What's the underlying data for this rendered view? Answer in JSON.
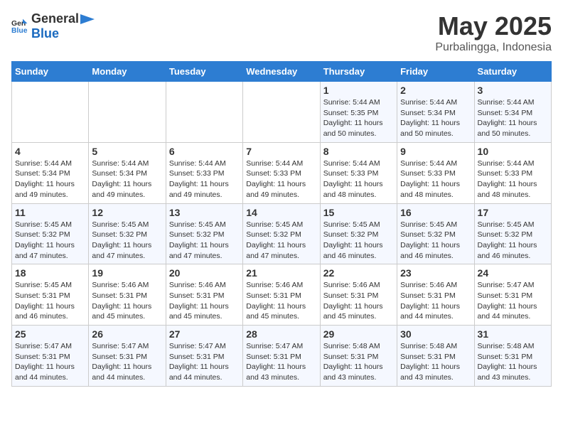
{
  "header": {
    "logo_general": "General",
    "logo_blue": "Blue",
    "month": "May 2025",
    "location": "Purbalingga, Indonesia"
  },
  "weekdays": [
    "Sunday",
    "Monday",
    "Tuesday",
    "Wednesday",
    "Thursday",
    "Friday",
    "Saturday"
  ],
  "weeks": [
    [
      {
        "day": "",
        "info": ""
      },
      {
        "day": "",
        "info": ""
      },
      {
        "day": "",
        "info": ""
      },
      {
        "day": "",
        "info": ""
      },
      {
        "day": "1",
        "info": "Sunrise: 5:44 AM\nSunset: 5:35 PM\nDaylight: 11 hours and 50 minutes."
      },
      {
        "day": "2",
        "info": "Sunrise: 5:44 AM\nSunset: 5:34 PM\nDaylight: 11 hours and 50 minutes."
      },
      {
        "day": "3",
        "info": "Sunrise: 5:44 AM\nSunset: 5:34 PM\nDaylight: 11 hours and 50 minutes."
      }
    ],
    [
      {
        "day": "4",
        "info": "Sunrise: 5:44 AM\nSunset: 5:34 PM\nDaylight: 11 hours and 49 minutes."
      },
      {
        "day": "5",
        "info": "Sunrise: 5:44 AM\nSunset: 5:34 PM\nDaylight: 11 hours and 49 minutes."
      },
      {
        "day": "6",
        "info": "Sunrise: 5:44 AM\nSunset: 5:33 PM\nDaylight: 11 hours and 49 minutes."
      },
      {
        "day": "7",
        "info": "Sunrise: 5:44 AM\nSunset: 5:33 PM\nDaylight: 11 hours and 49 minutes."
      },
      {
        "day": "8",
        "info": "Sunrise: 5:44 AM\nSunset: 5:33 PM\nDaylight: 11 hours and 48 minutes."
      },
      {
        "day": "9",
        "info": "Sunrise: 5:44 AM\nSunset: 5:33 PM\nDaylight: 11 hours and 48 minutes."
      },
      {
        "day": "10",
        "info": "Sunrise: 5:44 AM\nSunset: 5:33 PM\nDaylight: 11 hours and 48 minutes."
      }
    ],
    [
      {
        "day": "11",
        "info": "Sunrise: 5:45 AM\nSunset: 5:32 PM\nDaylight: 11 hours and 47 minutes."
      },
      {
        "day": "12",
        "info": "Sunrise: 5:45 AM\nSunset: 5:32 PM\nDaylight: 11 hours and 47 minutes."
      },
      {
        "day": "13",
        "info": "Sunrise: 5:45 AM\nSunset: 5:32 PM\nDaylight: 11 hours and 47 minutes."
      },
      {
        "day": "14",
        "info": "Sunrise: 5:45 AM\nSunset: 5:32 PM\nDaylight: 11 hours and 47 minutes."
      },
      {
        "day": "15",
        "info": "Sunrise: 5:45 AM\nSunset: 5:32 PM\nDaylight: 11 hours and 46 minutes."
      },
      {
        "day": "16",
        "info": "Sunrise: 5:45 AM\nSunset: 5:32 PM\nDaylight: 11 hours and 46 minutes."
      },
      {
        "day": "17",
        "info": "Sunrise: 5:45 AM\nSunset: 5:32 PM\nDaylight: 11 hours and 46 minutes."
      }
    ],
    [
      {
        "day": "18",
        "info": "Sunrise: 5:45 AM\nSunset: 5:31 PM\nDaylight: 11 hours and 46 minutes."
      },
      {
        "day": "19",
        "info": "Sunrise: 5:46 AM\nSunset: 5:31 PM\nDaylight: 11 hours and 45 minutes."
      },
      {
        "day": "20",
        "info": "Sunrise: 5:46 AM\nSunset: 5:31 PM\nDaylight: 11 hours and 45 minutes."
      },
      {
        "day": "21",
        "info": "Sunrise: 5:46 AM\nSunset: 5:31 PM\nDaylight: 11 hours and 45 minutes."
      },
      {
        "day": "22",
        "info": "Sunrise: 5:46 AM\nSunset: 5:31 PM\nDaylight: 11 hours and 45 minutes."
      },
      {
        "day": "23",
        "info": "Sunrise: 5:46 AM\nSunset: 5:31 PM\nDaylight: 11 hours and 44 minutes."
      },
      {
        "day": "24",
        "info": "Sunrise: 5:47 AM\nSunset: 5:31 PM\nDaylight: 11 hours and 44 minutes."
      }
    ],
    [
      {
        "day": "25",
        "info": "Sunrise: 5:47 AM\nSunset: 5:31 PM\nDaylight: 11 hours and 44 minutes."
      },
      {
        "day": "26",
        "info": "Sunrise: 5:47 AM\nSunset: 5:31 PM\nDaylight: 11 hours and 44 minutes."
      },
      {
        "day": "27",
        "info": "Sunrise: 5:47 AM\nSunset: 5:31 PM\nDaylight: 11 hours and 44 minutes."
      },
      {
        "day": "28",
        "info": "Sunrise: 5:47 AM\nSunset: 5:31 PM\nDaylight: 11 hours and 43 minutes."
      },
      {
        "day": "29",
        "info": "Sunrise: 5:48 AM\nSunset: 5:31 PM\nDaylight: 11 hours and 43 minutes."
      },
      {
        "day": "30",
        "info": "Sunrise: 5:48 AM\nSunset: 5:31 PM\nDaylight: 11 hours and 43 minutes."
      },
      {
        "day": "31",
        "info": "Sunrise: 5:48 AM\nSunset: 5:31 PM\nDaylight: 11 hours and 43 minutes."
      }
    ]
  ]
}
